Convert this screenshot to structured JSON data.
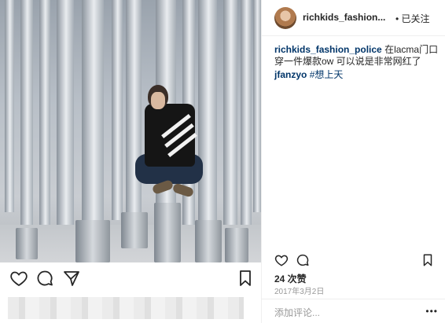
{
  "post": {
    "username": "richkids_fashion...",
    "follow_label": "• 已关注",
    "caption_user": "richkids_fashion_police",
    "caption_text": "在lacma门口穿一件爆款ow 可以说是非常网红了",
    "comment_user": "jfanzyo",
    "comment_tag": "#想上天",
    "likes": "24 次赞",
    "date": "2017年3月2日",
    "add_comment_placeholder": "添加评论...",
    "more_label": "•••"
  },
  "icons": [
    "heart-icon",
    "comment-icon",
    "share-icon",
    "bookmark-icon",
    "more-icon"
  ]
}
